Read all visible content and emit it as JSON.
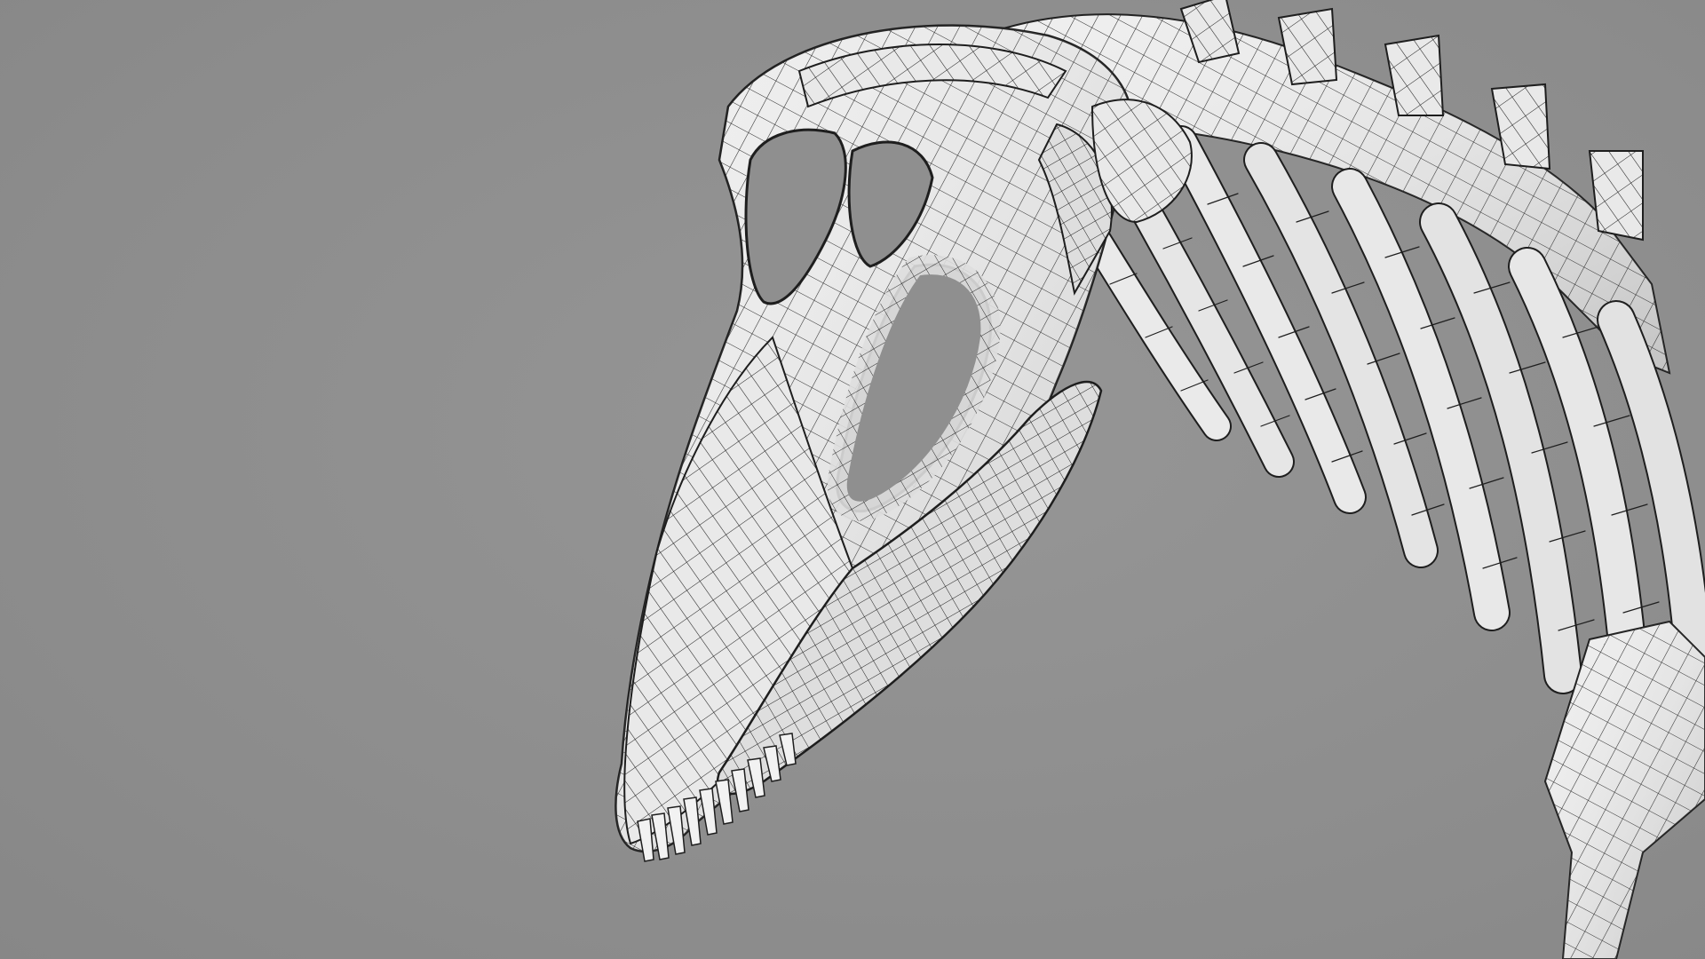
{
  "scene": {
    "subject": "dinosaur-skeleton-wireframe",
    "colors": {
      "background": "#8f8f8f",
      "bone_fill": "#eeeeee",
      "bone_shadow": "#c9c9c9",
      "wire": "#1e1e1e"
    }
  }
}
